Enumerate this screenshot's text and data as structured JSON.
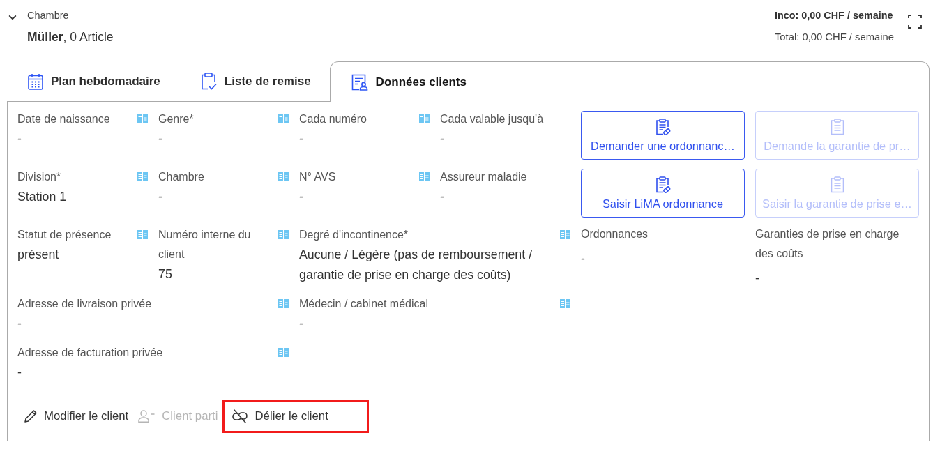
{
  "header": {
    "expanded": true,
    "label": "Chambre",
    "title": "**Müller**, 0 Article",
    "inco": "Inco: 0,00 CHF / semaine",
    "total": "Total: 0,00 CHF / semaine"
  },
  "tabs": [
    {
      "label": "Plan hebdomadaire",
      "kind": "calendar",
      "selected": false
    },
    {
      "label": "Liste de remise",
      "kind": "checklist",
      "selected": false
    },
    {
      "label": "Données clients",
      "kind": "profile",
      "selected": true
    }
  ],
  "field_rows": [
    {
      "fields": [
        {
          "label": "Date de naissance",
          "value": "-",
          "synced": true
        },
        {
          "label": "Genre*",
          "value": "-",
          "synced": true
        },
        {
          "label": "Cada numéro",
          "value": "-",
          "synced": true
        },
        {
          "label": "Cada valable jusqu'à",
          "value": "-",
          "synced": false
        }
      ]
    },
    {
      "fields": [
        {
          "label": "Division*",
          "value": "Station 1",
          "synced": true
        },
        {
          "label": "Chambre",
          "value": "-",
          "synced": true
        },
        {
          "label": "N° AVS",
          "value": "-",
          "synced": true
        },
        {
          "label": "Assureur maladie",
          "value": "-",
          "synced": false
        }
      ]
    },
    {
      "fields": [
        {
          "label": "Statut de présence",
          "value": "présent",
          "synced": true
        },
        {
          "label": "Numéro interne du client",
          "value": "75",
          "synced": true
        },
        {
          "label": "Degré d'incontinence*",
          "value": "Aucune / Légère (pas de remboursement / garantie de prise en charge des coûts)",
          "synced": true
        }
      ]
    },
    {
      "fields": [
        {
          "label": "Adresse de livraison privée",
          "value": "-",
          "synced": true
        },
        {
          "label": "Médecin / cabinet médical",
          "value": "-",
          "synced": true
        }
      ]
    },
    {
      "fields": [
        {
          "label": "Adresse de facturation privée",
          "value": "-",
          "synced": true
        }
      ]
    }
  ],
  "requests": {
    "buttons": [
      {
        "label": "Demander une ordonnanc…",
        "kind": "prescription",
        "disabled": false
      },
      {
        "label": "Demande la garantie de pr…",
        "kind": "guarantee",
        "disabled": true
      },
      {
        "label": "Saisir LiMA ordonnance",
        "kind": "prescription",
        "disabled": false
      },
      {
        "label": "Saisir la garantie de prise e…",
        "kind": "guarantee",
        "disabled": true
      }
    ],
    "fields": [
      {
        "label": "Ordonnances",
        "value": "-"
      },
      {
        "label": "Garanties de prise en charge des coûts",
        "value": "-"
      }
    ]
  },
  "actions": [
    {
      "label": "Modifier le client",
      "kind": "edit",
      "disabled": false,
      "highlighted": false
    },
    {
      "label": "Client parti",
      "kind": "leave",
      "disabled": true,
      "highlighted": false
    },
    {
      "label": "Délier le client",
      "kind": "unlink",
      "disabled": false,
      "highlighted": true
    }
  ]
}
